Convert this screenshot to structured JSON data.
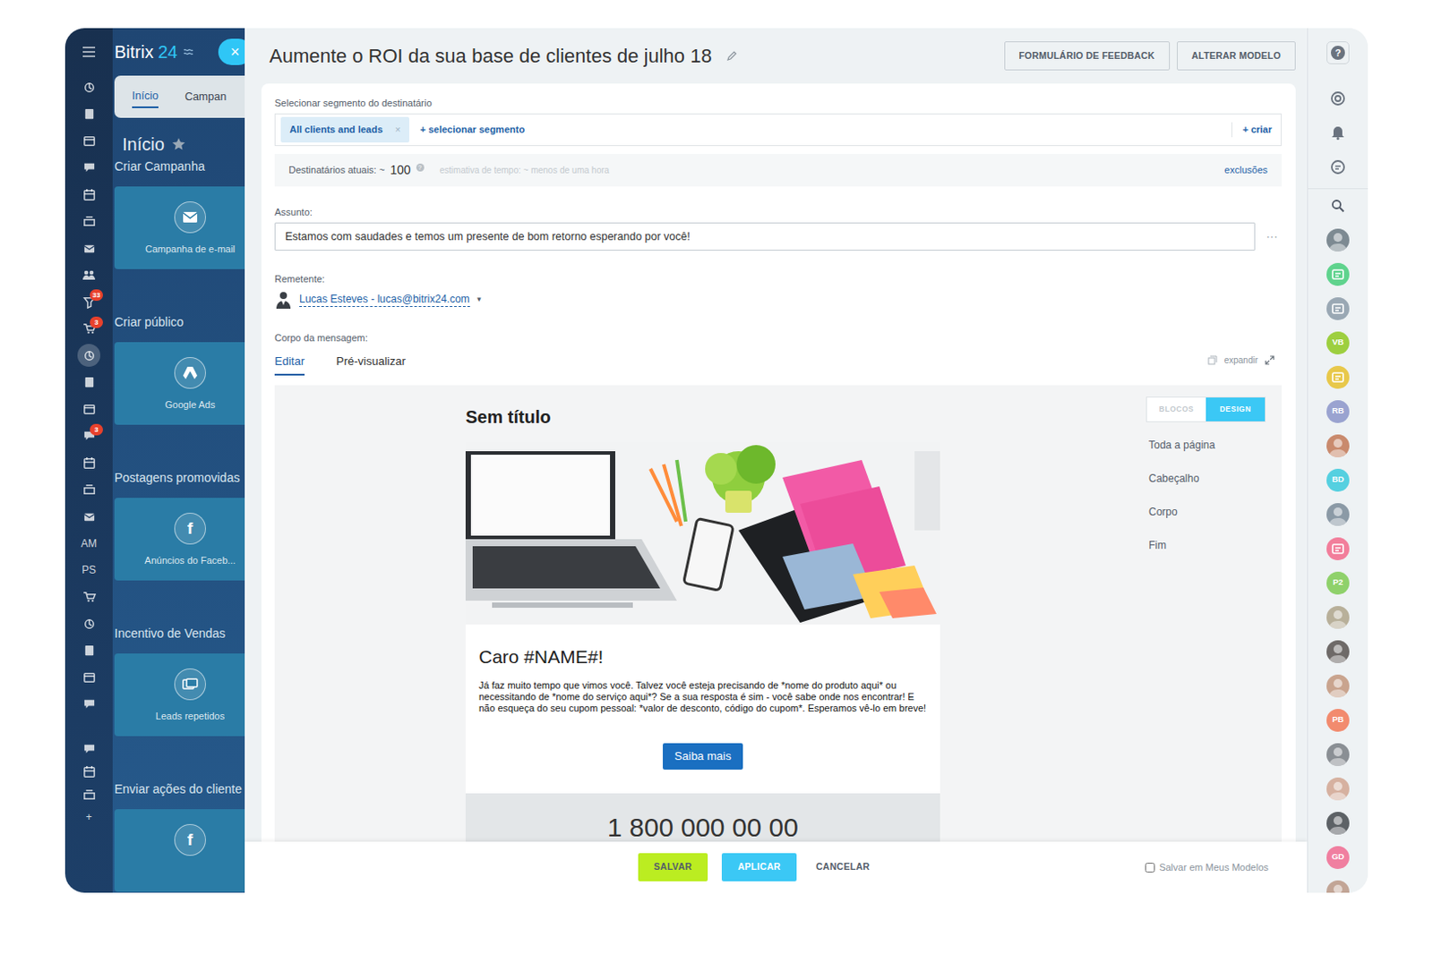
{
  "window": {
    "title": "Aumente o ROI da sua base de clientes de julho 18"
  },
  "nav": {
    "logo_brand": "Bitrix",
    "logo_number": "24",
    "close": "×",
    "strip": [
      {
        "kind": "icon",
        "selected": false
      },
      {
        "kind": "icon",
        "selected": false
      },
      {
        "kind": "icon",
        "selected": false
      },
      {
        "kind": "icon",
        "selected": false
      },
      {
        "kind": "icon",
        "selected": false
      },
      {
        "kind": "icon",
        "selected": false
      },
      {
        "kind": "icon",
        "selected": false
      },
      {
        "kind": "icon",
        "selected": false
      },
      {
        "kind": "icon",
        "selected": false,
        "badge": "33"
      },
      {
        "kind": "icon",
        "selected": false,
        "badge": "3"
      },
      {
        "kind": "icon",
        "selected": true
      },
      {
        "kind": "icon",
        "selected": false
      },
      {
        "kind": "icon",
        "selected": false
      },
      {
        "kind": "icon",
        "selected": false,
        "badge": "3"
      },
      {
        "kind": "icon",
        "selected": false
      },
      {
        "kind": "icon",
        "selected": false
      },
      {
        "kind": "icon",
        "selected": false
      },
      {
        "kind": "text",
        "label": "AM",
        "selected": false
      },
      {
        "kind": "text",
        "label": "PS",
        "selected": false
      },
      {
        "kind": "icon",
        "selected": false
      },
      {
        "kind": "icon",
        "selected": false
      },
      {
        "kind": "icon",
        "selected": false
      },
      {
        "kind": "icon",
        "selected": false
      },
      {
        "kind": "icon",
        "selected": false
      }
    ],
    "strip_bottom": [
      {
        "kind": "icon",
        "selected": false
      },
      {
        "kind": "icon",
        "selected": false
      },
      {
        "kind": "icon",
        "selected": false
      },
      {
        "kind": "text",
        "label": "+",
        "selected": false
      }
    ],
    "tabs": [
      {
        "label": "Início",
        "selected": true
      },
      {
        "label": "Campan",
        "selected": false
      }
    ],
    "heading": "Início",
    "sections": [
      {
        "title": "Criar Campanha",
        "card": "Campanha de e-mail"
      },
      {
        "title": "Criar público",
        "card": "Google Ads"
      },
      {
        "title": "Postagens promovidas",
        "card": "Anúncios do Faceb...",
        "glyph": "f"
      },
      {
        "title": "Incentivo de Vendas",
        "card": "Leads repetidos"
      },
      {
        "title": "Enviar ações do cliente",
        "glyph": "f"
      }
    ]
  },
  "header": {
    "buttons": [
      "FORMULÁRIO DE FEEDBACK",
      "ALTERAR MODELO"
    ]
  },
  "segment": {
    "label": "Selecionar segmento do destinatário",
    "tags": [
      {
        "label": "All clients and leads",
        "remove": "×"
      }
    ],
    "add": "+ selecionar segmento",
    "create": "+ criar"
  },
  "recipients": {
    "label": "Destinatários atuais: ~",
    "count": "100",
    "help": "?",
    "estimate": "estimativa de tempo: ~ menos de uma hora",
    "exclusions": "exclusões"
  },
  "subject": {
    "label": "Assunto:",
    "value": "Estamos com saudades e temos um presente de bom retorno esperando por você!",
    "more": "···"
  },
  "sender": {
    "label": "Remetente:",
    "value": "Lucas Esteves - lucas@bitrix24.com",
    "caret": "▾"
  },
  "body": {
    "label": "Corpo da mensagem:",
    "tabs": [
      {
        "label": "Editar",
        "selected": true
      },
      {
        "label": "Pré-visualizar",
        "selected": false
      }
    ],
    "expand": "expandir"
  },
  "editor": {
    "title": "Sem título",
    "greeting": "Caro #NAME#!",
    "text": "Já faz muito tempo que vimos você. Talvez você esteja precisando de *nome do produto aqui* ou necessitando de *nome do serviço aqui*? Se a sua resposta é sim - você sabe onde nos encontrar! E não esqueça do seu cupom pessoal: *valor de desconto, código do cupom*. Esperamos vê-lo em breve!",
    "button": "Saiba mais",
    "amount": "1 800 000 00 00",
    "modes": [
      {
        "label": "BLOCOS",
        "selected": false
      },
      {
        "label": "DESIGN",
        "selected": true
      }
    ],
    "sections": [
      "Toda a página",
      "Cabeçalho",
      "Corpo",
      "Fim"
    ]
  },
  "footer": {
    "buttons": [
      {
        "label": "SALVAR",
        "kind": "save"
      },
      {
        "label": "APLICAR",
        "kind": "apply"
      },
      {
        "label": "CANCELAR",
        "kind": "cancel"
      }
    ],
    "save_template": {
      "label": "Salvar em Meus Modelos",
      "checked": false
    }
  },
  "right_bar": {
    "items": [
      {
        "kind": "help",
        "label": "?"
      },
      {
        "kind": "icon"
      },
      {
        "kind": "icon"
      },
      {
        "kind": "icon"
      },
      {
        "kind": "search"
      },
      {
        "kind": "photo",
        "color": "#7d8a92"
      },
      {
        "kind": "app",
        "color": "#5fd38d"
      },
      {
        "kind": "app",
        "color": "#9aa8b4"
      },
      {
        "kind": "initials",
        "label": "VB",
        "color": "#9dcf3f"
      },
      {
        "kind": "app",
        "color": "#e8c84a"
      },
      {
        "kind": "initials",
        "label": "RB",
        "color": "#9aa3d0"
      },
      {
        "kind": "photo",
        "color": "#c98a6d"
      },
      {
        "kind": "initials",
        "label": "BD",
        "color": "#55d0e0"
      },
      {
        "kind": "photo",
        "color": "#8b9aa6"
      },
      {
        "kind": "app",
        "color": "#f27e9b"
      },
      {
        "kind": "initials",
        "label": "P2",
        "color": "#8fd16b"
      },
      {
        "kind": "photo",
        "color": "#b8b09a"
      },
      {
        "kind": "photo",
        "color": "#6e6a68"
      },
      {
        "kind": "photo",
        "color": "#c9a48e"
      },
      {
        "kind": "initials",
        "label": "PB",
        "color": "#f28b6e"
      },
      {
        "kind": "photo",
        "color": "#8a8f94"
      },
      {
        "kind": "photo",
        "color": "#d6b1a0"
      },
      {
        "kind": "photo",
        "color": "#5d6266"
      },
      {
        "kind": "initials",
        "label": "GD",
        "color": "#f07fa0"
      },
      {
        "kind": "photo",
        "color": "#c2a596"
      }
    ]
  }
}
